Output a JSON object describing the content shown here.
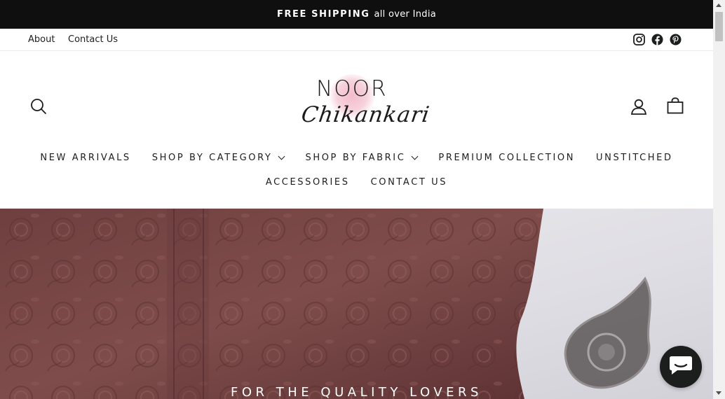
{
  "announcement": {
    "strong": "FREE SHIPPING",
    "rest": "all over India"
  },
  "utility": {
    "links": [
      "About",
      "Contact Us"
    ],
    "social": [
      "instagram-icon",
      "facebook-icon",
      "pinterest-icon"
    ]
  },
  "header": {
    "logo": {
      "line1": "NOOR",
      "line2": "Chikankari"
    },
    "icons": [
      "search-icon",
      "user-icon",
      "bag-icon"
    ]
  },
  "nav": {
    "row1": [
      {
        "label": "NEW ARRIVALS",
        "dropdown": false
      },
      {
        "label": "SHOP BY CATEGORY",
        "dropdown": true
      },
      {
        "label": "SHOP BY FABRIC",
        "dropdown": true
      },
      {
        "label": "PREMIUM COLLECTION",
        "dropdown": false
      },
      {
        "label": "UNSTITCHED",
        "dropdown": false
      }
    ],
    "row2": [
      {
        "label": "ACCESSORIES",
        "dropdown": false
      },
      {
        "label": "CONTACT US",
        "dropdown": false
      }
    ]
  },
  "hero": {
    "caption": "FOR THE QUALITY LOVERS"
  },
  "chat": {
    "icon": "chat-icon"
  },
  "colors": {
    "announcement_bg": "#0f0f0f",
    "fabric": "#7a4a49",
    "marble": "#e6e6ea",
    "chat_bg": "#1c1d1d"
  }
}
